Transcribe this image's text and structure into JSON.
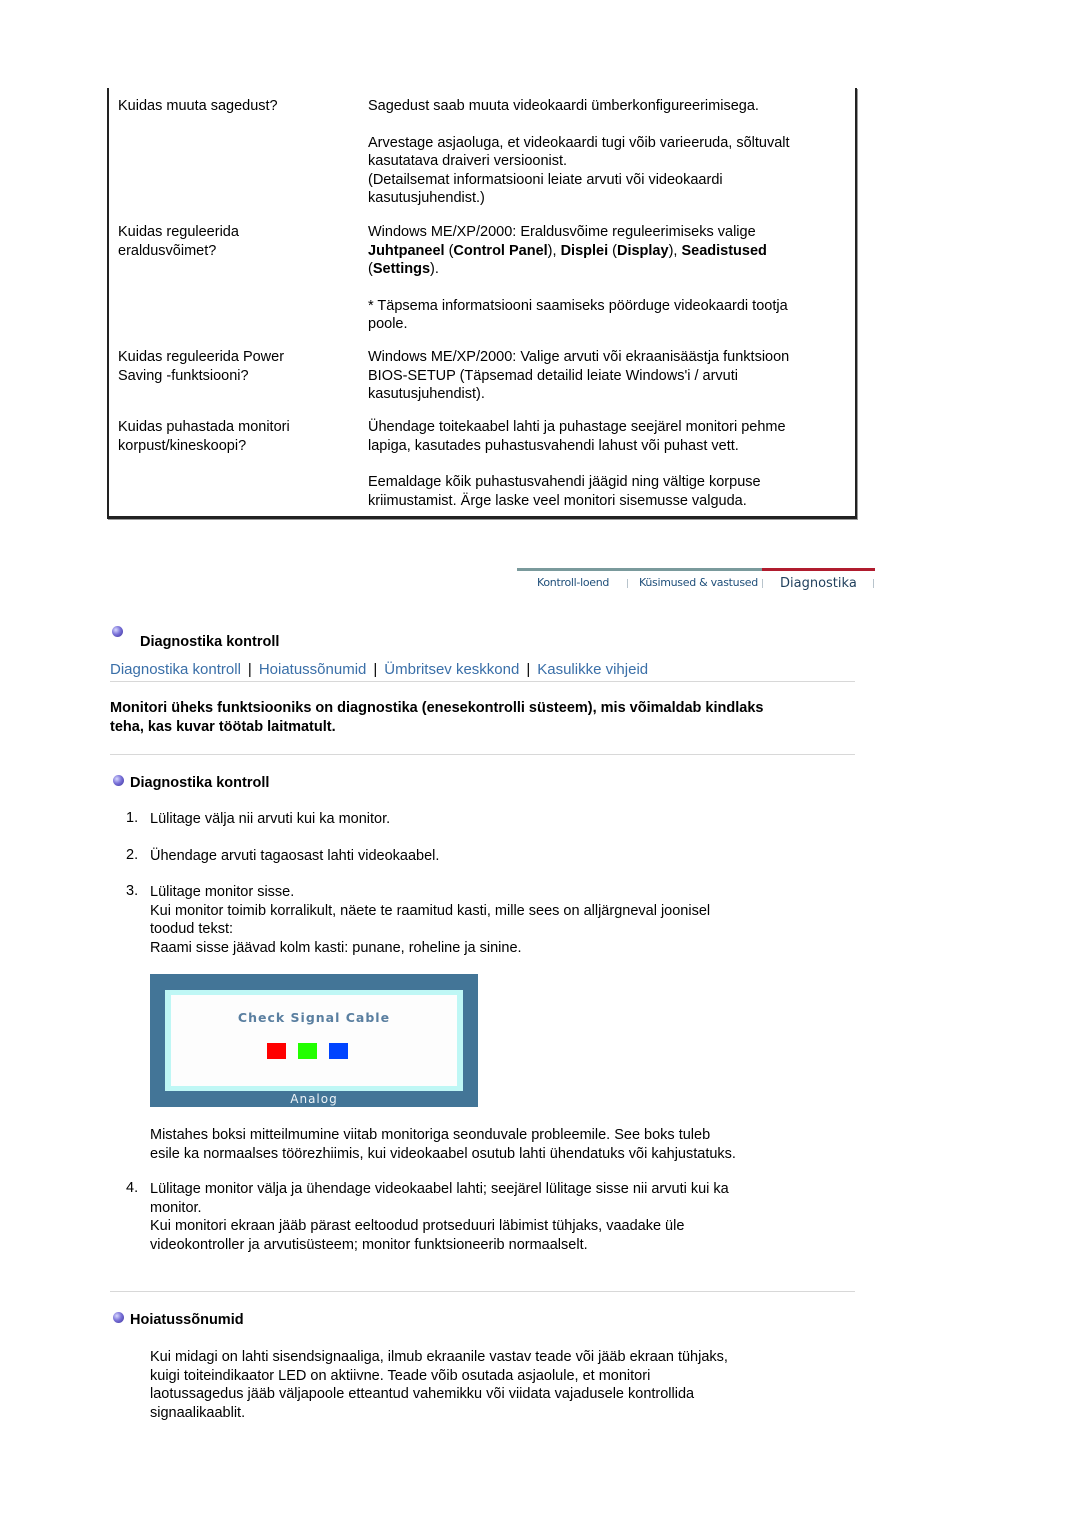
{
  "faq": [
    {
      "question": [
        "Kuidas muuta sagedust?"
      ],
      "answers": [
        "Sagedust saab muuta videokaardi ümberkonfigureerimisega.",
        "Arvestage asjaoluga, et videokaardi tugi võib varieeruda, sõltuvalt",
        "kasutatava draiveri versioonist.",
        "(Detailsemat informatsiooni leiate arvuti või videokaardi",
        "kasutusjuhendist.)"
      ]
    },
    {
      "question": [
        "Kuidas reguleerida",
        "eraldusvõimet?"
      ],
      "answers": {
        "line1": "Windows ME/XP/2000: Eraldusvõime reguleerimiseks valige",
        "b1": "Juhtpaneel",
        "t1": " (",
        "b2": "Control Panel",
        "t2": "), ",
        "b3": "Displei",
        "t3": " (",
        "b4": "Display",
        "t4": "), ",
        "b5": "Seadistused",
        "t5": "(",
        "b6": "Settings",
        "t6": ").",
        "note1": "* Täpsema informatsiooni saamiseks pöörduge videokaardi tootja",
        "note2": "poole."
      }
    },
    {
      "question": [
        "Kuidas reguleerida Power",
        "Saving -funktsiooni?"
      ],
      "answers": [
        "Windows ME/XP/2000: Valige arvuti või ekraanisäästja funktsioon",
        "BIOS-SETUP (Täpsemad detailid leiate Windows'i / arvuti",
        "kasutusjuhendist)."
      ]
    },
    {
      "question": [
        "Kuidas puhastada monitori",
        "korpust/kineskoopi?"
      ],
      "answers": [
        "Ühendage toitekaabel lahti ja puhastage seejärel monitori pehme",
        "lapiga, kasutades puhastusvahendi lahust või puhast vett.",
        "Eemaldage kõik puhastusvahendi jäägid ning vältige korpuse",
        "kriimustamist. Ärge laske veel monitori sisemusse valguda."
      ]
    }
  ],
  "nav_tabs": [
    {
      "label": "Kontroll-loend",
      "active": false
    },
    {
      "label": "Küsimused & vastused",
      "active": false
    },
    {
      "label": "Diagnostika",
      "active": true
    }
  ],
  "section_title": "Diagnostika kontroll",
  "links": [
    "Diagnostika kontroll",
    "Hoiatussõnumid",
    "Ümbritsev keskkond",
    "Kasulikke vihjeid"
  ],
  "intro": [
    "Monitori üheks funktsiooniks on diagnostika (enesekontrolli süsteem), mis võimaldab kindlaks",
    "teha, kas kuvar töötab laitmatult."
  ],
  "diag": {
    "title": "Diagnostika kontroll",
    "steps": [
      {
        "num": "1.",
        "lines": [
          "Lülitage välja nii arvuti kui ka monitor."
        ]
      },
      {
        "num": "2.",
        "lines": [
          "Ühendage arvuti tagaosast lahti videokaabel."
        ]
      },
      {
        "num": "3.",
        "lines": [
          "Lülitage monitor sisse.",
          "Kui monitor toimib korralikult, näete te raamitud kasti, mille sees on alljärgneval joonisel",
          "toodud tekst:",
          "Raami sisse jäävad kolm kasti: punane, roheline ja sinine."
        ]
      },
      {
        "num": "4.",
        "lines": [
          "Lülitage monitor välja ja ühendage videokaabel lahti; seejärel lülitage sisse nii arvuti kui ka",
          "monitor.",
          "Kui monitori ekraan jääb pärast eeltoodud protseduuri läbimist tühjaks, vaadake üle",
          "videokontroller ja arvutisüsteem; monitor funktsioneerib normaalselt."
        ]
      }
    ],
    "after_image": [
      "Mistahes boksi mitteilmumine viitab monitoriga seonduvale probleemile. See boks tuleb",
      "esile ka normaalses töörezhiimis, kui videokaabel osutub lahti ühendatuks või kahjustatuks."
    ]
  },
  "monitor_graphic": {
    "message": "Check Signal Cable",
    "input_label": "Analog",
    "colors": {
      "red": "#ff0000",
      "green": "#22ff00",
      "blue": "#0044ff",
      "frame": "#437597",
      "bezel": "#bff7f5"
    }
  },
  "warnings": {
    "title": "Hoiatussõnumid",
    "lines": [
      "Kui midagi on lahti sisendsignaaliga, ilmub ekraanile vastav teade või jääb ekraan tühjaks,",
      "kuigi toiteindikaator LED on aktiivne. Teade võib osutada asjaolule, et monitori",
      "laotussagedus jääb väljapoole etteantud vahemikku või viidata vajadusele kontrollida",
      "signaalikaablit."
    ]
  }
}
